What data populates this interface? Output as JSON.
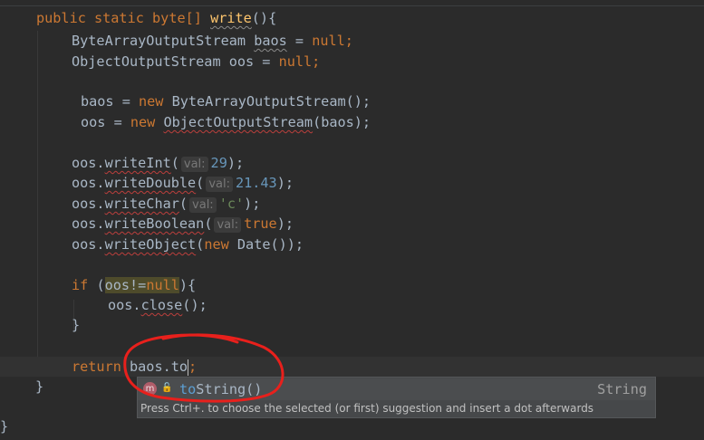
{
  "editor": {
    "language": "java",
    "method_signature": {
      "modifiers": "public static",
      "return_type": "byte[]",
      "name": "write",
      "params": "(){"
    },
    "decl_baos": {
      "type": "ByteArrayOutputStream",
      "name": "baos",
      "op": " = ",
      "value": "null",
      "end": ";"
    },
    "decl_oos": {
      "type": "ObjectOutputStream oos = ",
      "value": "null",
      "end": ";"
    },
    "assign_baos": {
      "lhs": "baos = ",
      "kw_new": "new",
      "ctor": " ByteArrayOutputStream();"
    },
    "assign_oos": {
      "lhs": "oos = ",
      "kw_new": "new",
      "ctor": "ObjectOutputStream",
      "args": "(baos);"
    },
    "calls": [
      {
        "recv": "oos.",
        "method": "writeInt",
        "open": "(",
        "hint": "val:",
        "arg": "29",
        "arg_kind": "num",
        "close": ");"
      },
      {
        "recv": "oos.",
        "method": "writeDouble",
        "open": "(",
        "hint": "val:",
        "arg": "21.43",
        "arg_kind": "num",
        "close": ");"
      },
      {
        "recv": "oos.",
        "method": "writeChar",
        "open": "(",
        "hint": "val:",
        "arg": "'c'",
        "arg_kind": "str",
        "close": ");"
      },
      {
        "recv": "oos.",
        "method": "writeBoolean",
        "open": "(",
        "hint": "val:",
        "arg": "true",
        "arg_kind": "kw",
        "close": ");"
      }
    ],
    "write_object": {
      "recv": "oos.",
      "method": "writeObject",
      "open": "(",
      "kw_new": "new",
      "rest": " Date());"
    },
    "if_stmt": {
      "kw": "if",
      "open": " (",
      "cond_var": "oos!=",
      "cond_null": "null",
      "close": "){"
    },
    "close_call": {
      "recv": "oos.",
      "method": "close",
      "rest": "();"
    },
    "closing_brace": "}",
    "return_stmt": {
      "kw": "return",
      "expr": " baos.to",
      "end": ";"
    },
    "method_close": "}",
    "class_close": "}"
  },
  "completion_popup": {
    "items": [
      {
        "icon": "m",
        "visibility_icon": "lock-open-icon",
        "name_match": "to",
        "name_rest": "String()",
        "type": "String"
      }
    ],
    "hint": "Press Ctrl+. to choose the selected (or first) suggestion and insert a dot afterwards"
  },
  "colors": {
    "background": "#2b2b2b",
    "keyword": "#cc7832",
    "method_decl": "#ffc66d",
    "number": "#6897bb",
    "string": "#6a8759",
    "text": "#a9b7c6",
    "error_squiggle": "#bc3f3c",
    "annotation_circle": "#e8201c"
  }
}
